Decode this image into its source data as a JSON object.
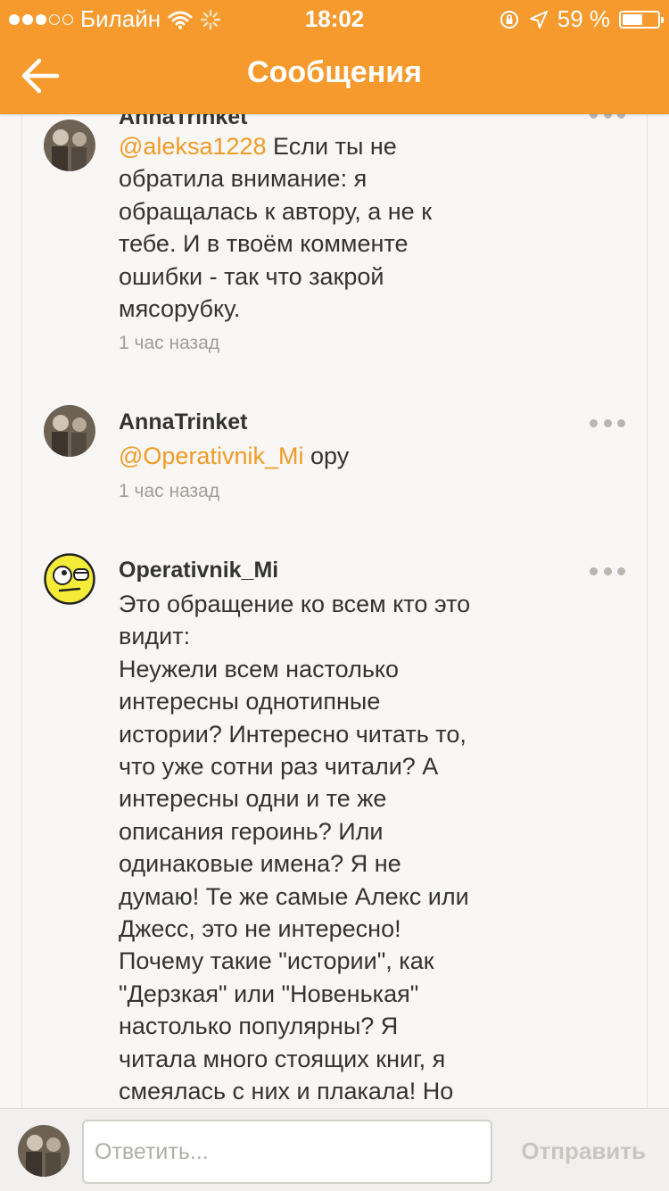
{
  "status_bar": {
    "carrier": "Билайн",
    "time": "18:02",
    "battery_text": "59 %",
    "battery_level": 0.59
  },
  "nav": {
    "title": "Сообщения",
    "back_icon": "arrow-left-icon"
  },
  "comments": [
    {
      "author": "AnnaTrinket",
      "mention": "@aleksa1228",
      "lines": [
        " Если ты не",
        "обратила внимание: я",
        "обращалась к автору, а не к",
        "тебе. И в твоём комменте",
        "ошибки - так что закрой",
        "мясорубку."
      ],
      "time": "1 час назад"
    },
    {
      "author": "AnnaTrinket",
      "mention": "@Operativnik_Mi",
      "lines": [
        " ору"
      ],
      "time": "1 час назад"
    },
    {
      "author": "Operativnik_Mi",
      "lines": [
        "Это обращение ко всем кто это",
        "видит:",
        "Неужели всем настолько",
        "интересны однотипные",
        "истории? Интересно читать то,",
        "что уже сотни раз читали? А",
        "интересны одни и те же",
        "описания героинь? Или",
        "одинаковые имена? Я не",
        "думаю! Те же самые Алекс или",
        "Джесс, это не интересно!",
        "Почему такие \"истории\", как",
        "\"Дерзкая\" или \"Новенькая\"",
        "настолько популярны? Я",
        "читала много стоящих книг, я",
        "смеялась с них и плакала! Но"
      ]
    }
  ],
  "composer": {
    "placeholder": "Ответить...",
    "send_label": "Отправить"
  },
  "colors": {
    "accent": "#f79a2d",
    "mention": "#f29a26"
  }
}
